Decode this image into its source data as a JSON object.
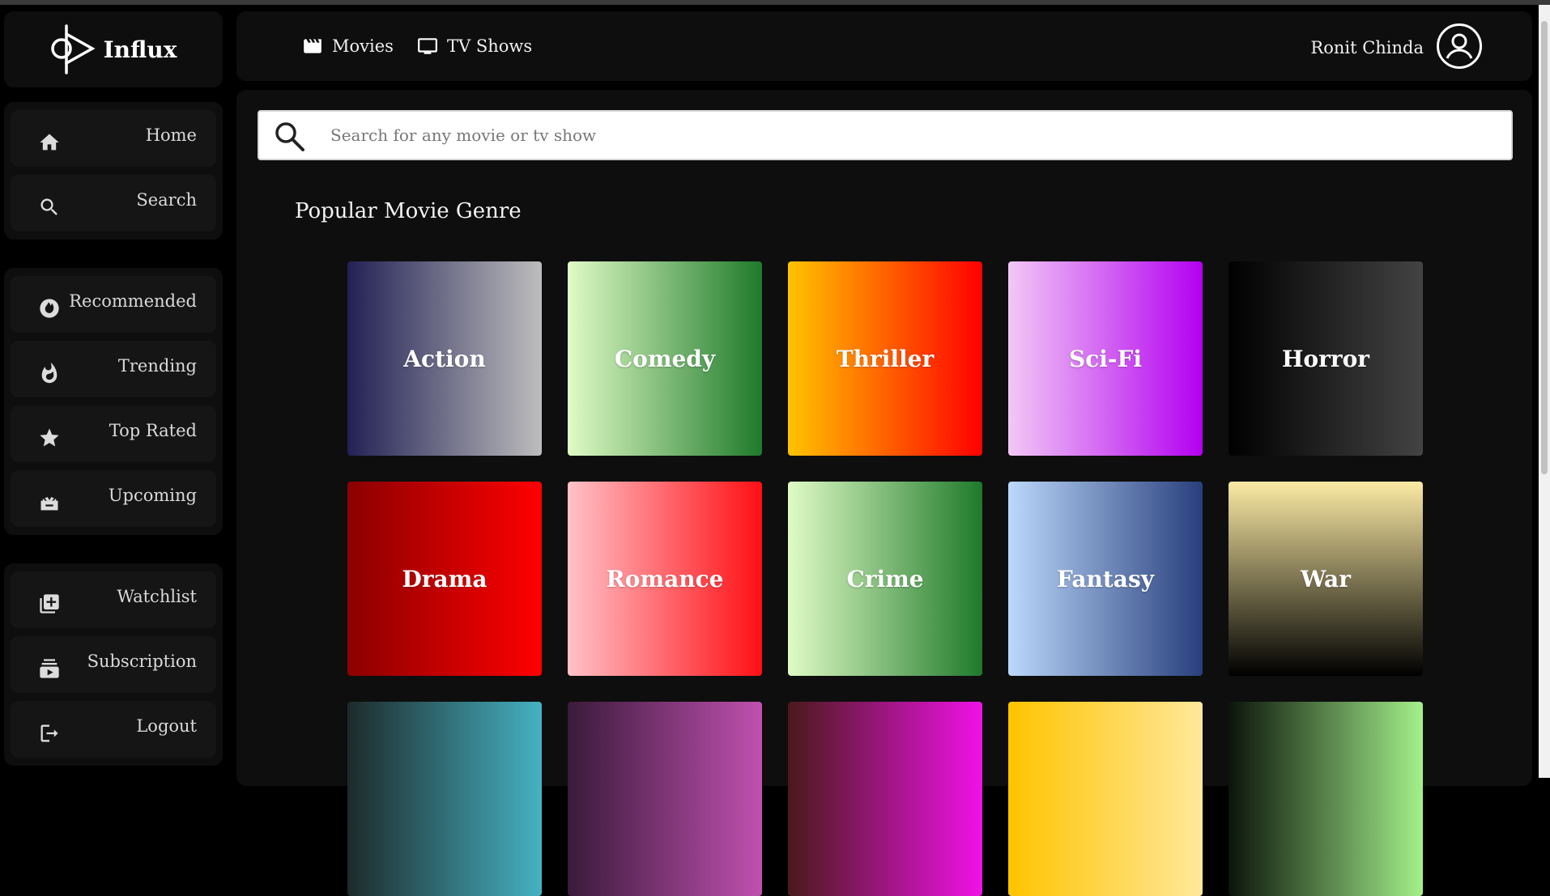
{
  "app": {
    "name": "Influx"
  },
  "sidebar": {
    "groups": [
      [
        {
          "label": "Home",
          "icon": "home-icon"
        },
        {
          "label": "Search",
          "icon": "search-icon"
        }
      ],
      [
        {
          "label": "Recommended",
          "icon": "recommended-icon"
        },
        {
          "label": "Trending",
          "icon": "fire-icon"
        },
        {
          "label": "Top Rated",
          "icon": "star-icon"
        },
        {
          "label": "Upcoming",
          "icon": "upcoming-icon"
        }
      ],
      [
        {
          "label": "Watchlist",
          "icon": "add-list-icon"
        },
        {
          "label": "Subscription",
          "icon": "subscription-icon"
        },
        {
          "label": "Logout",
          "icon": "logout-icon"
        }
      ]
    ]
  },
  "header": {
    "movies_label": "Movies",
    "tv_label": "TV Shows",
    "user_name": "Ronit Chinda"
  },
  "search": {
    "placeholder": "Search for any movie or tv show"
  },
  "main": {
    "section_title": "Popular Movie Genre"
  },
  "genres": [
    {
      "label": "Action",
      "gradient": [
        "#222155",
        "#bdbdbd"
      ]
    },
    {
      "label": "Comedy",
      "gradient": [
        "#e0fbc6",
        "#1f7a2b"
      ]
    },
    {
      "label": "Thriller",
      "gradient": [
        "#ffc300",
        "#ff0000"
      ]
    },
    {
      "label": "Sci-Fi",
      "gradient": [
        "#f2c8f5",
        "#b300f0"
      ]
    },
    {
      "label": "Horror",
      "gradient": [
        "#000000",
        "#434343"
      ]
    },
    {
      "label": "Drama",
      "gradient": [
        "#8b0000",
        "#ff0000"
      ]
    },
    {
      "label": "Romance",
      "gradient": [
        "#ffc2c8",
        "#ff0f14"
      ]
    },
    {
      "label": "Crime",
      "gradient": [
        "#e0fbc6",
        "#1f7a2b"
      ]
    },
    {
      "label": "Fantasy",
      "gradient": [
        "#bcd8fb",
        "#283f7c"
      ]
    },
    {
      "label": "War",
      "gradient": [
        "#fbeaa4",
        "#000000"
      ]
    },
    {
      "label": "",
      "gradient": [
        "#1e2a2a",
        "#45b2c2"
      ]
    },
    {
      "label": "",
      "gradient": [
        "#3a1a3a",
        "#c050b0"
      ]
    },
    {
      "label": "",
      "gradient": [
        "#4a1a1a",
        "#f012e6"
      ]
    },
    {
      "label": "",
      "gradient": [
        "#ffc400",
        "#ffe89a"
      ]
    },
    {
      "label": "",
      "gradient": [
        "#0b140b",
        "#a4f08a"
      ]
    }
  ]
}
